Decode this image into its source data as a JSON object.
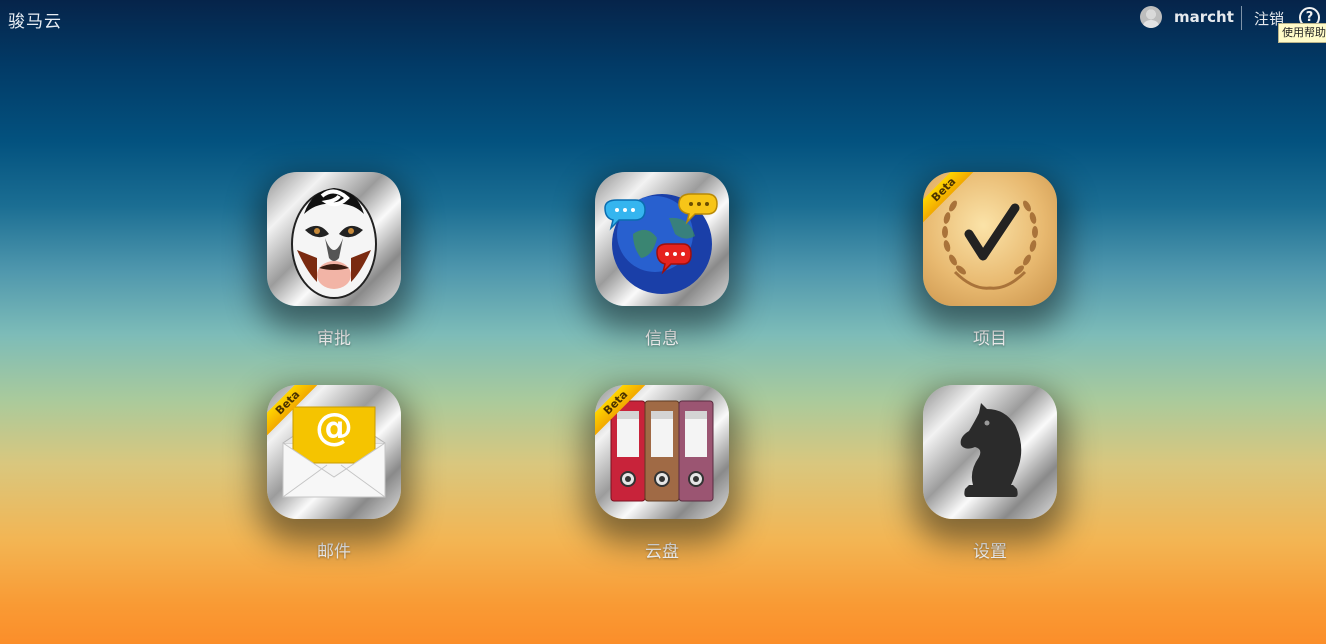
{
  "header": {
    "brand": "骏马云",
    "username": "marcht",
    "logout_label": "注销",
    "help_symbol": "?",
    "help_tooltip": "使用帮助"
  },
  "apps": [
    {
      "label": "审批",
      "icon": "opera-mask-icon",
      "beta": false
    },
    {
      "label": "信息",
      "icon": "globe-chat-icon",
      "beta": false
    },
    {
      "label": "项目",
      "icon": "laurel-check-icon",
      "beta": true
    },
    {
      "label": "邮件",
      "icon": "envelope-at-icon",
      "beta": true
    },
    {
      "label": "云盘",
      "icon": "binders-icon",
      "beta": true
    },
    {
      "label": "设置",
      "icon": "chess-knight-icon",
      "beta": false
    }
  ],
  "beta_label": "Beta",
  "mail_symbol": "@",
  "colors": {
    "background_top": "#06244a",
    "background_bottom": "#fb8e2a",
    "beta_ribbon": "#ffd400",
    "tooltip_bg": "#fffbc8"
  }
}
